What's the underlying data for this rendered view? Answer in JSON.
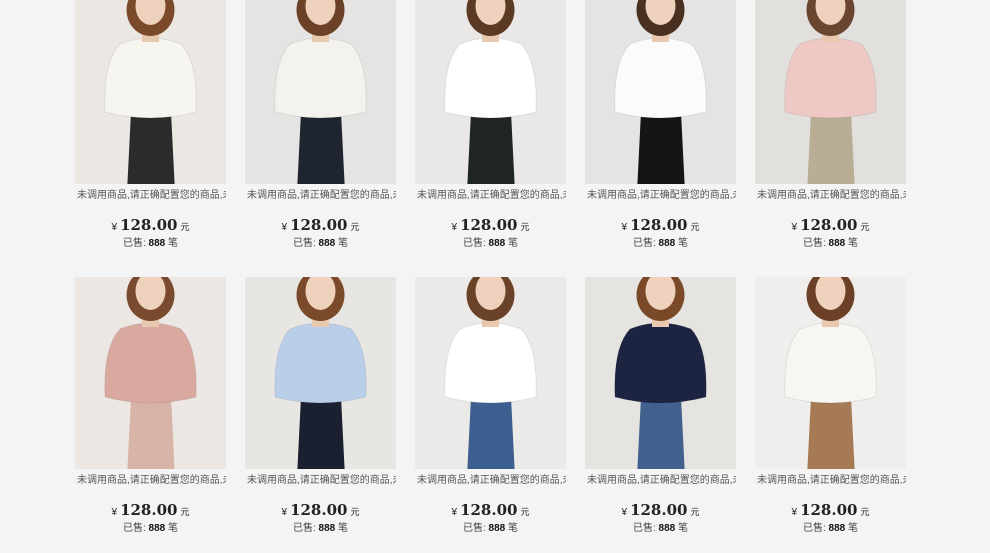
{
  "products": [
    {
      "title": "未调用商品,请正确配置您的商品,未调用商品,请正确配置您的商品",
      "currency": "¥",
      "price": "128.00",
      "price_unit": "元",
      "sold_label": "已售:",
      "sold_count": "888",
      "sold_unit": "笔",
      "colors": {
        "bg": "#ebe8e4",
        "top": "#f7f5f0",
        "bottom": "#2b2b2b",
        "hair": "#7a4a2a"
      }
    },
    {
      "title": "未调用商品,请正确配置您的商品,未调用商品,请正确配置您的商品",
      "currency": "¥",
      "price": "128.00",
      "price_unit": "元",
      "sold_label": "已售:",
      "sold_count": "888",
      "sold_unit": "笔",
      "colors": {
        "bg": "#e6e4e2",
        "top": "#f4f2ef",
        "bottom": "#1e2430",
        "hair": "#6b4228"
      }
    },
    {
      "title": "未调用商品,请正确配置您的商品,未调用商品,请正确配置您的商品",
      "currency": "¥",
      "price": "128.00",
      "price_unit": "元",
      "sold_label": "已售:",
      "sold_count": "888",
      "sold_unit": "笔",
      "colors": {
        "bg": "#e9e8e6",
        "top": "#ffffff",
        "bottom": "#1f2522",
        "hair": "#5a3a24"
      }
    },
    {
      "title": "未调用商品,请正确配置您的商品,未调用商品,请正确配置您的商品",
      "currency": "¥",
      "price": "128.00",
      "price_unit": "元",
      "sold_label": "已售:",
      "sold_count": "888",
      "sold_unit": "笔",
      "colors": {
        "bg": "#e4e4e4",
        "top": "#fbfbfb",
        "bottom": "#151515",
        "hair": "#4a3020"
      }
    },
    {
      "title": "未调用商品,请正确配置您的商品,未调用商品,请正确配置您的商品",
      "currency": "¥",
      "price": "128.00",
      "price_unit": "元",
      "sold_label": "已售:",
      "sold_count": "888",
      "sold_unit": "笔",
      "colors": {
        "bg": "#e2e0dd",
        "top": "#eec9c4",
        "bottom": "#b9ad96",
        "hair": "#6a4530"
      }
    },
    {
      "title": "未调用商品,请正确配置您的商品,未调用商品,请正确配置您的商品",
      "currency": "¥",
      "price": "128.00",
      "price_unit": "元",
      "sold_label": "已售:",
      "sold_count": "888",
      "sold_unit": "笔",
      "colors": {
        "bg": "#ece7e2",
        "top": "#d9a9a0",
        "bottom": "#d8b4a8",
        "hair": "#7a4a2e"
      }
    },
    {
      "title": "未调用商品,请正确配置您的商品,未调用商品,请正确配置您的商品",
      "currency": "¥",
      "price": "128.00",
      "price_unit": "元",
      "sold_label": "已售:",
      "sold_count": "888",
      "sold_unit": "笔",
      "colors": {
        "bg": "#e8e6e3",
        "top": "#b9cfe9",
        "bottom": "#1b2030",
        "hair": "#7a4a2a"
      }
    },
    {
      "title": "未调用商品,请正确配置您的商品,未调用商品,请正确配置您的商品",
      "currency": "¥",
      "price": "128.00",
      "price_unit": "元",
      "sold_label": "已售:",
      "sold_count": "888",
      "sold_unit": "笔",
      "colors": {
        "bg": "#ebeae8",
        "top": "#ffffff",
        "bottom": "#3d5f8f",
        "hair": "#6a4228"
      }
    },
    {
      "title": "未调用商品,请正确配置您的商品,未调用商品,请正确配置您的商品",
      "currency": "¥",
      "price": "128.00",
      "price_unit": "元",
      "sold_label": "已售:",
      "sold_count": "888",
      "sold_unit": "笔",
      "colors": {
        "bg": "#e6e4e1",
        "top": "#1c2442",
        "bottom": "#42618e",
        "hair": "#7a4a28"
      }
    },
    {
      "title": "未调用商品,请正确配置您的商品,未调用商品,请正确配置您的商品",
      "currency": "¥",
      "price": "128.00",
      "price_unit": "元",
      "sold_label": "已售:",
      "sold_count": "888",
      "sold_unit": "笔",
      "colors": {
        "bg": "#efeeec",
        "top": "#f8f6f2",
        "bottom": "#a57a54",
        "hair": "#6b4026"
      }
    }
  ]
}
